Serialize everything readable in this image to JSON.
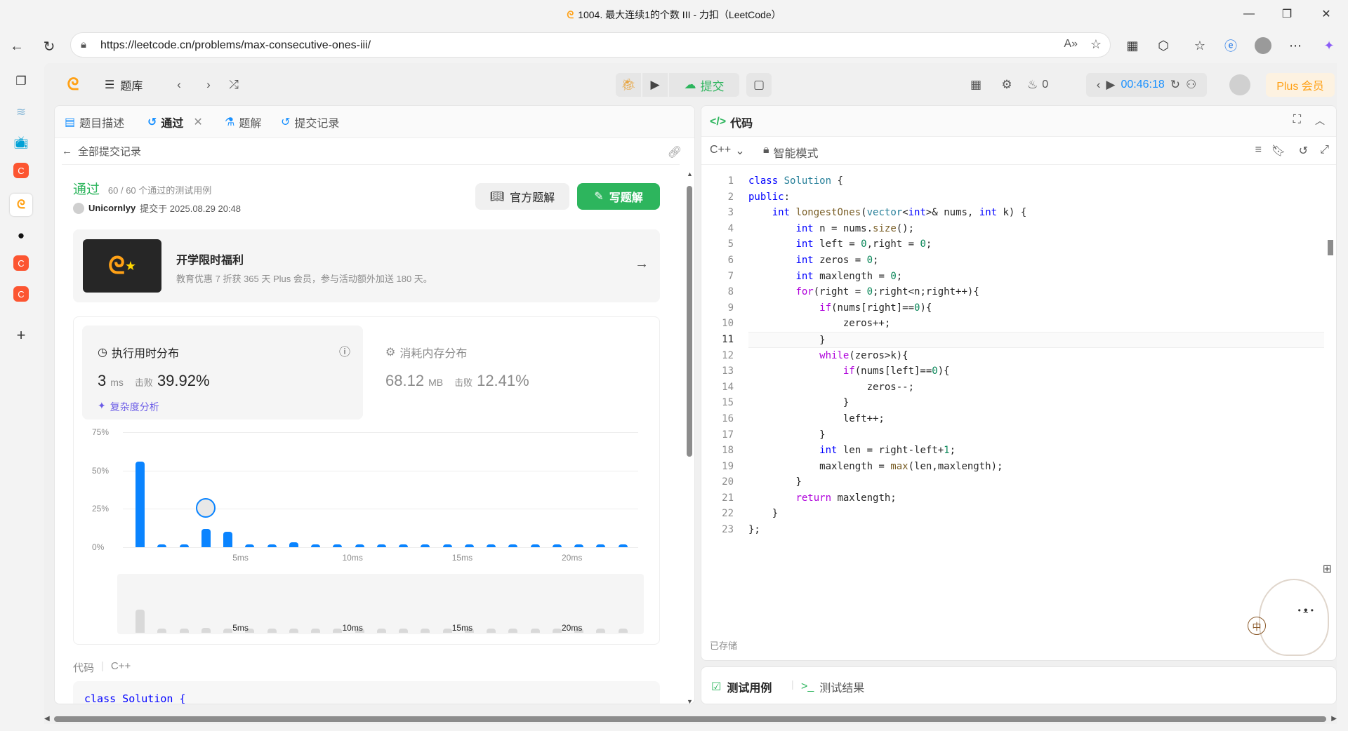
{
  "browser": {
    "window_title": "1004. 最大连续1的个数 III - 力扣（LeetCode）",
    "url": "https://leetcode.cn/problems/max-consecutive-ones-iii/"
  },
  "header": {
    "problem_list_label": "题库",
    "submit_label": "提交",
    "streak_count": "0",
    "timer": "00:46:18",
    "plus_label": "Plus 会员"
  },
  "left_tabs": [
    {
      "label": "题目描述"
    },
    {
      "label": "通过"
    },
    {
      "label": "题解"
    },
    {
      "label": "提交记录"
    }
  ],
  "submission": {
    "back_label": "全部提交记录",
    "status": "通过",
    "testcases": "60 / 60 个通过的测试用例",
    "user": "Unicornlyy",
    "submitted_at": "提交于 2025.08.29 20:48",
    "official_solution_label": "官方题解",
    "write_solution_label": "写题解"
  },
  "promo": {
    "title": "开学限时福利",
    "desc": "教育优惠 7 折获 365 天 Plus 会员，参与活动额外加送 180 天。"
  },
  "runtime": {
    "title": "执行用时分布",
    "value": "3",
    "unit": "ms",
    "beats_label": "击败",
    "beats": "39.92%",
    "complexity_label": "复杂度分析"
  },
  "memory": {
    "title": "消耗内存分布",
    "value": "68.12",
    "unit": "MB",
    "beats_label": "击败",
    "beats": "12.41%"
  },
  "chart_data": {
    "type": "bar",
    "ylim": [
      0,
      75
    ],
    "y_ticks": [
      "75%",
      "50%",
      "25%",
      "0%"
    ],
    "x_ticks": [
      "5ms",
      "10ms",
      "15ms",
      "20ms"
    ],
    "mini_x_ticks": [
      "5ms",
      "10ms",
      "15ms",
      "20ms"
    ],
    "values": [
      56,
      2,
      2,
      12,
      10,
      2,
      2,
      3,
      2,
      2,
      2,
      2,
      2,
      2,
      2,
      2,
      2,
      2,
      2,
      2,
      2,
      2,
      2
    ],
    "highlight_index": 3,
    "color": "#0a84ff"
  },
  "bottom_code": {
    "label": "代码",
    "lang": "C++",
    "first_line": "class Solution {"
  },
  "editor": {
    "title": "代码",
    "lang": "C++",
    "mode": "智能模式",
    "saved": "已存储",
    "lines": [
      "class Solution {",
      "public:",
      "    int longestOnes(vector<int>& nums, int k) {",
      "        int n = nums.size();",
      "        int left = 0,right = 0;",
      "        int zeros = 0;",
      "        int maxlength = 0;",
      "        for(right = 0;right<n;right++){",
      "            if(nums[right]==0){",
      "                zeros++;",
      "            }",
      "            while(zeros>k){",
      "                if(nums[left]==0){",
      "                    zeros--;",
      "                }",
      "                left++;",
      "            }",
      "            int len = right-left+1;",
      "            maxlength = max(len,maxlength);",
      "        }",
      "        return maxlength;",
      "    }",
      "};"
    ]
  },
  "bottom_tabs": {
    "testcase": "测试用例",
    "result": "测试结果"
  },
  "mascot": {
    "badge": "中"
  }
}
